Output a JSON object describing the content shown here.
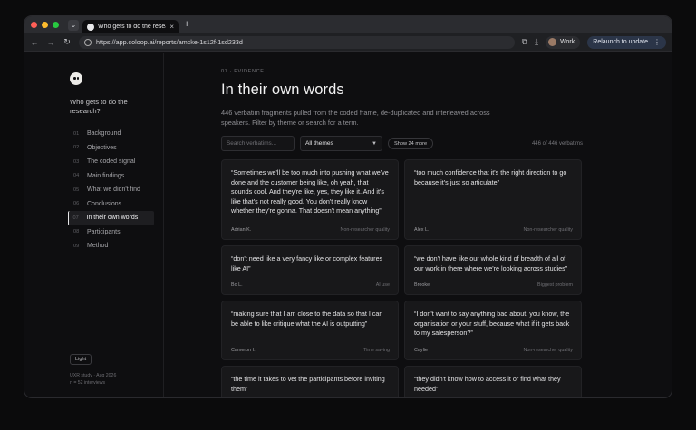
{
  "browser": {
    "tab_title": "Who gets to do the research?",
    "url": "https://app.coloop.ai/reports/amcke-1s12f-1sd233d",
    "profile_label": "Work",
    "update_label": "Relaunch to update"
  },
  "sidebar": {
    "study_title": "Who gets to do the research?",
    "items": [
      {
        "num": "01",
        "label": "Background"
      },
      {
        "num": "02",
        "label": "Objectives"
      },
      {
        "num": "03",
        "label": "The coded signal"
      },
      {
        "num": "04",
        "label": "Main findings"
      },
      {
        "num": "05",
        "label": "What we didn't find"
      },
      {
        "num": "06",
        "label": "Conclusions"
      },
      {
        "num": "07",
        "label": "In their own words"
      },
      {
        "num": "08",
        "label": "Participants"
      },
      {
        "num": "09",
        "label": "Method"
      }
    ],
    "theme_toggle": "Light",
    "meta_line1": "UXR study · Aug 2026",
    "meta_line2": "n = 52 interviews"
  },
  "main": {
    "eyebrow": "07 · EVIDENCE",
    "title": "In their own words",
    "intro": "446 verbatim fragments pulled from the coded frame, de-duplicated and interleaved across speakers. Filter by theme or search for a term.",
    "search_placeholder": "Search verbatims...",
    "theme_select": "All themes",
    "show_more": "Show 24 more",
    "count": "446 of 446 verbatims",
    "cards": [
      {
        "quote": "“Sometimes we'll be too much into pushing what we've done and the customer being like, oh yeah, that sounds cool. And they're like, yes, they like it. And it's like that's not really good. You don't really know whether they're gonna. That doesn't mean anything”",
        "speaker": "Adrian K.",
        "tag": "Non-researcher quality"
      },
      {
        "quote": "“too much confidence that it's the right direction to go because it's just so articulate”",
        "speaker": "Alex L.",
        "tag": "Non-researcher quality"
      },
      {
        "quote": "“don't need like a very fancy like or complex features like AI”",
        "speaker": "Bo L.",
        "tag": "AI use"
      },
      {
        "quote": "“we don't have like our whole kind of breadth of all of our work in there where we're looking across studies”",
        "speaker": "Brooke",
        "tag": "Biggest problem"
      },
      {
        "quote": "“making sure that I am close to the data so that I can be able to like critique what the AI is outputting”",
        "speaker": "Cameron I.",
        "tag": "Time saving"
      },
      {
        "quote": "“I don't want to say anything bad about, you know, the organisation or your stuff, because what if it gets back to my salesperson?”",
        "speaker": "Caylie",
        "tag": "Non-researcher quality"
      },
      {
        "quote": "“the time it takes to vet the participants before inviting them”",
        "speaker": "",
        "tag": ""
      },
      {
        "quote": "“they didn't know how to access it or find what they needed”",
        "speaker": "",
        "tag": ""
      }
    ]
  },
  "colors": {
    "background": "#0e0e10",
    "card": "#18181a",
    "text": "#f2f2f3",
    "muted": "#8f8f94"
  }
}
